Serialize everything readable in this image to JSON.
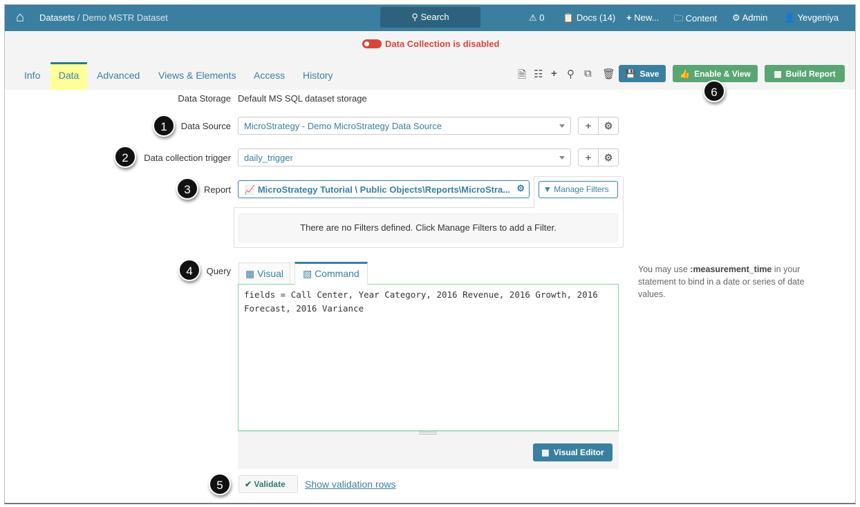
{
  "header": {
    "breadcrumb_root": "Datasets",
    "breadcrumb_sep": " / ",
    "breadcrumb_current": "Demo MSTR Dataset",
    "search_label": "Search",
    "alerts_count": "0",
    "docs_label": "Docs (14)",
    "new_label": "New...",
    "content_label": "Content",
    "admin_label": "Admin",
    "user_label": "Yevgeniya"
  },
  "status": {
    "message": "Data Collection is disabled",
    "color": "#d9453b"
  },
  "tabs": [
    {
      "label": "Info"
    },
    {
      "label": "Data"
    },
    {
      "label": "Advanced"
    },
    {
      "label": "Views & Elements"
    },
    {
      "label": "Access"
    },
    {
      "label": "History"
    }
  ],
  "toolbar": {
    "save_label": "Save",
    "enable_view_label": "Enable & View",
    "build_report_label": "Build Report"
  },
  "form": {
    "data_storage_label": "Data Storage",
    "data_storage_value": "Default MS SQL dataset storage",
    "data_source_label": "Data Source",
    "data_source_value": "MicroStrategy - Demo MicroStrategy Data Source",
    "trigger_label": "Data collection trigger",
    "trigger_value": "daily_trigger",
    "report_label": "Report",
    "report_value": "MicroStrategy Tutorial \\ Public Objects\\Reports\\MicroStra...",
    "manage_filters_label": "Manage Filters",
    "no_filters_text": "There are no Filters defined. Click Manage Filters to add a Filter.",
    "query_label": "Query",
    "query_tab_visual": "Visual",
    "query_tab_command": "Command",
    "query_text": "fields = Call Center, Year Category, 2016 Revenue, 2016 Growth, 2016\nForecast, 2016 Variance",
    "visual_editor_label": "Visual Editor",
    "help_pre": "You may use ",
    "help_bold": ":measurement_time",
    "help_post": " in your statement to bind in a date or series of date values.",
    "validate_label": "Validate",
    "show_rows_label": "Show validation rows"
  },
  "badges": [
    "1",
    "2",
    "3",
    "4",
    "5",
    "6"
  ]
}
